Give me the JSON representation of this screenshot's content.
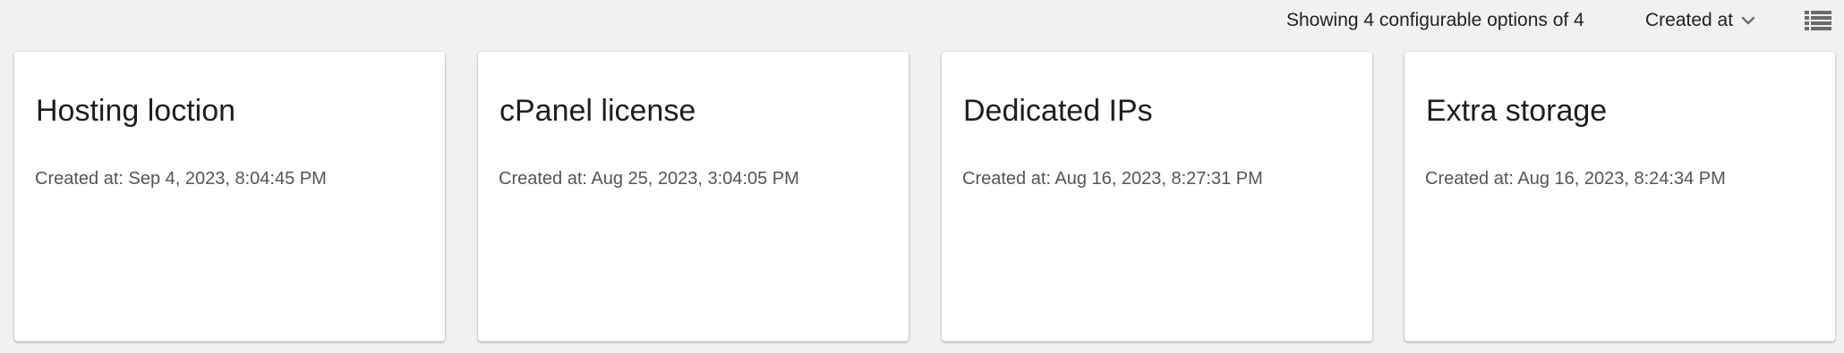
{
  "toolbar": {
    "showing_text": "Showing 4 configurable options of 4",
    "sort_label": "Created at",
    "sort_icon": "chevron-down-icon",
    "view_icon": "list-view-icon"
  },
  "cards": [
    {
      "title": "Hosting loction",
      "created": "Created at: Sep 4, 2023, 8:04:45 PM"
    },
    {
      "title": "cPanel license",
      "created": "Created at: Aug 25, 2023, 3:04:05 PM"
    },
    {
      "title": "Dedicated IPs",
      "created": "Created at: Aug 16, 2023, 8:27:31 PM"
    },
    {
      "title": "Extra storage",
      "created": "Created at: Aug 16, 2023, 8:24:34 PM"
    }
  ],
  "colors": {
    "background": "#f1f1f1",
    "card": "#ffffff",
    "text": "#1e1e1e",
    "muted_text": "#555555",
    "icon": "#6b6b6b"
  }
}
